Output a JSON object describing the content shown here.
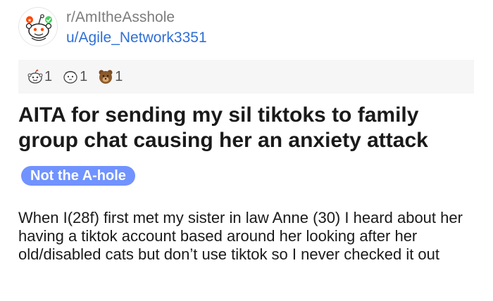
{
  "post": {
    "subreddit": "r/AmItheAsshole",
    "author": "u/Agile_Network3351",
    "awards": [
      {
        "icon": "wholesome-award-icon",
        "count": "1"
      },
      {
        "icon": "helpful-award-icon",
        "count": "1"
      },
      {
        "icon": "bear-award-icon",
        "count": "1"
      }
    ],
    "title": "AITA for sending my sil tiktoks to family group chat causing her an anxiety attack",
    "flair": "Not the A-hole",
    "body": "When I(28f) first met my sister in law Anne (30) I heard about her having a tiktok account based around her looking after her old/disabled cats but don’t use tiktok so I never checked it out"
  },
  "colors": {
    "flair_bg": "#7193ff",
    "author_link": "#2f6fd6",
    "awards_bar_bg": "#f6f6f7"
  }
}
